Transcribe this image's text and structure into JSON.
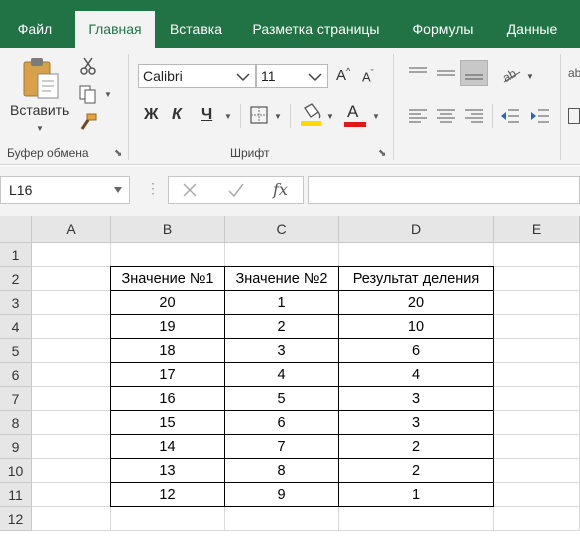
{
  "ribbon_tabs": [
    {
      "label": "Файл",
      "active": false
    },
    {
      "label": "Главная",
      "active": true
    },
    {
      "label": "Вставка",
      "active": false
    },
    {
      "label": "Разметка страницы",
      "active": false
    },
    {
      "label": "Формулы",
      "active": false
    },
    {
      "label": "Данные",
      "active": false
    }
  ],
  "clipboard": {
    "paste_label": "Вставить",
    "group_label": "Буфер обмена"
  },
  "font": {
    "font_name": "Calibri",
    "font_size": "11",
    "grow_label": "A",
    "shrink_label": "A",
    "bold_label": "Ж",
    "italic_label": "К",
    "underline_label": "Ч",
    "font_color_label": "A",
    "group_label": "Шрифт"
  },
  "formula_bar": {
    "name_box": "L16",
    "fx_label": "fx",
    "formula": ""
  },
  "colors": {
    "accent": "#217346",
    "font_color": "#e01818",
    "fill_color": "#ffd800"
  },
  "sheet": {
    "columns": [
      "A",
      "B",
      "C",
      "D",
      "E"
    ],
    "rows": [
      "1",
      "2",
      "3",
      "4",
      "5",
      "6",
      "7",
      "8",
      "9",
      "10",
      "11",
      "12"
    ],
    "table": {
      "headers": [
        "Значение №1",
        "Значение №2",
        "Результат деления"
      ],
      "values": [
        [
          "20",
          "1",
          "20"
        ],
        [
          "19",
          "2",
          "10"
        ],
        [
          "18",
          "3",
          "6"
        ],
        [
          "17",
          "4",
          "4"
        ],
        [
          "16",
          "5",
          "3"
        ],
        [
          "15",
          "6",
          "3"
        ],
        [
          "14",
          "7",
          "2"
        ],
        [
          "13",
          "8",
          "2"
        ],
        [
          "12",
          "9",
          "1"
        ]
      ]
    }
  }
}
